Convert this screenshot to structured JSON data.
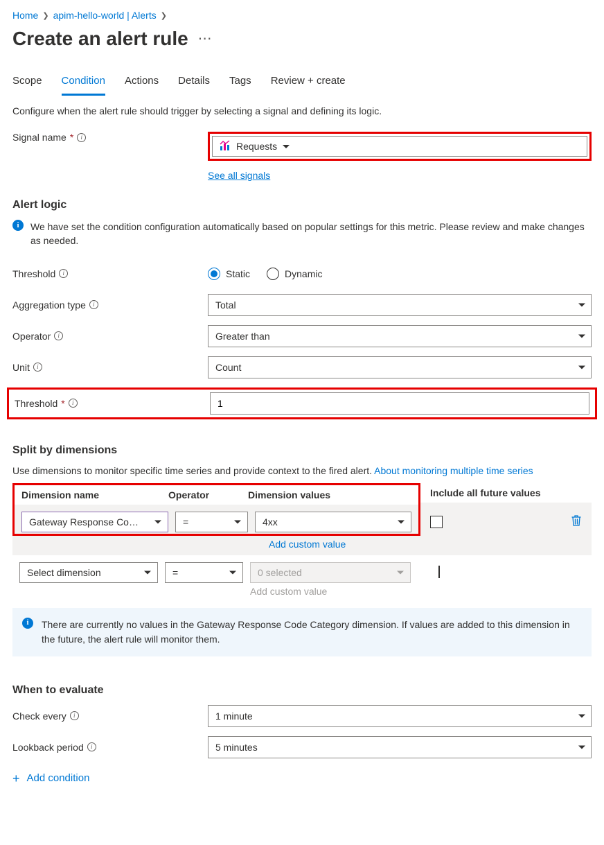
{
  "breadcrumb": {
    "home": "Home",
    "item2": "apim-hello-world | Alerts"
  },
  "page_title": "Create an alert rule",
  "tabs": {
    "scope": "Scope",
    "condition": "Condition",
    "actions": "Actions",
    "details": "Details",
    "tags": "Tags",
    "review": "Review + create"
  },
  "intro": "Configure when the alert rule should trigger by selecting a signal and defining its logic.",
  "signal": {
    "label": "Signal name",
    "value": "Requests",
    "see_all": "See all signals"
  },
  "alert_logic": {
    "heading": "Alert logic",
    "info": "We have set the condition configuration automatically based on popular settings for this metric. Please review and make changes as needed.",
    "threshold_label": "Threshold",
    "radio_static": "Static",
    "radio_dynamic": "Dynamic",
    "agg_label": "Aggregation type",
    "agg_value": "Total",
    "op_label": "Operator",
    "op_value": "Greater than",
    "unit_label": "Unit",
    "unit_value": "Count",
    "thr_label": "Threshold",
    "thr_value": "1"
  },
  "dimensions": {
    "heading": "Split by dimensions",
    "desc_text": "Use dimensions to monitor specific time series and provide context to the fired alert. ",
    "desc_link": "About monitoring multiple time series",
    "hdr_name": "Dimension name",
    "hdr_op": "Operator",
    "hdr_val": "Dimension values",
    "hdr_inc": "Include all future values",
    "row1": {
      "name": "Gateway Response Co…",
      "op": "=",
      "val": "4xx",
      "add_custom": "Add custom value"
    },
    "row2": {
      "name": "Select dimension",
      "op": "=",
      "val_placeholder": "0 selected",
      "add_custom": "Add custom value"
    },
    "note": "There are currently no values in the Gateway Response Code Category dimension. If values are added to this dimension in the future, the alert rule will monitor them."
  },
  "evaluate": {
    "heading": "When to evaluate",
    "check_label": "Check every",
    "check_value": "1 minute",
    "lookback_label": "Lookback period",
    "lookback_value": "5 minutes"
  },
  "add_condition": "Add condition"
}
